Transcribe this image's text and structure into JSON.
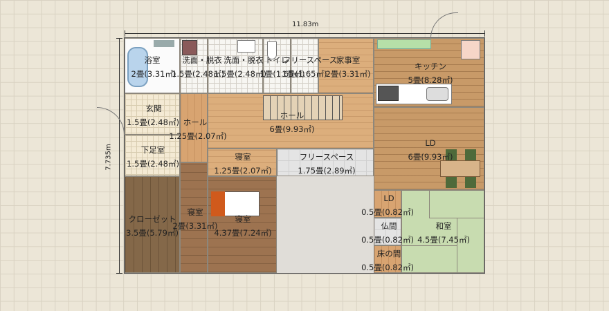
{
  "dimensions": {
    "width": "11.83m",
    "height": "7.735m"
  },
  "rooms": [
    {
      "id": "bathroom",
      "name": "浴室",
      "size": "2畳(3.31㎡)"
    },
    {
      "id": "washroom1",
      "name": "洗面・脱衣",
      "size": "1.5畳(2.48㎡)"
    },
    {
      "id": "washroom2",
      "name": "洗面・脱衣",
      "size": "1.5畳(2.48㎡)"
    },
    {
      "id": "toilet",
      "name": "トイレ",
      "size": "1畳(1.65㎡)"
    },
    {
      "id": "free-space-top",
      "name": "フリースペース",
      "size": "1畳(1.65㎡)"
    },
    {
      "id": "utility",
      "name": "家事室",
      "size": "2畳(3.31㎡)"
    },
    {
      "id": "kitchen",
      "name": "キッチン",
      "size": "5畳(8.28㎡)"
    },
    {
      "id": "entrance",
      "name": "玄関",
      "size": "1.5畳(2.48㎡)"
    },
    {
      "id": "hall-small",
      "name": "ホール",
      "size": "1.25畳(2.07㎡)"
    },
    {
      "id": "hall-main",
      "name": "ホール",
      "size": "6畳(9.93㎡)"
    },
    {
      "id": "ld-main",
      "name": "LD",
      "size": "6畳(9.93㎡)"
    },
    {
      "id": "shoe-room",
      "name": "下足室",
      "size": "1.5畳(2.48㎡)"
    },
    {
      "id": "bedroom-small",
      "name": "寝室",
      "size": "1.25畳(2.07㎡)"
    },
    {
      "id": "free-space-mid",
      "name": "フリースペース",
      "size": "1.75畳(2.89㎡)"
    },
    {
      "id": "closet",
      "name": "クローゼット",
      "size": "3.5畳(5.79㎡)"
    },
    {
      "id": "bedroom-narrow",
      "name": "寝室",
      "size": "2畳(3.31㎡)"
    },
    {
      "id": "bedroom-main",
      "name": "寝室",
      "size": "4.37畳(7.24㎡)"
    },
    {
      "id": "ld-small",
      "name": "LD",
      "size": "0.5畳(0.82㎡)"
    },
    {
      "id": "altar",
      "name": "仏間",
      "size": "0.5畳(0.82㎡)"
    },
    {
      "id": "alcove",
      "name": "床の間",
      "size": "0.5畳(0.82㎡)"
    },
    {
      "id": "washitsu",
      "name": "和室",
      "size": "4.5畳(7.45㎡)"
    }
  ],
  "colors": {
    "outline": "#8d877c",
    "wall": "#555555"
  }
}
